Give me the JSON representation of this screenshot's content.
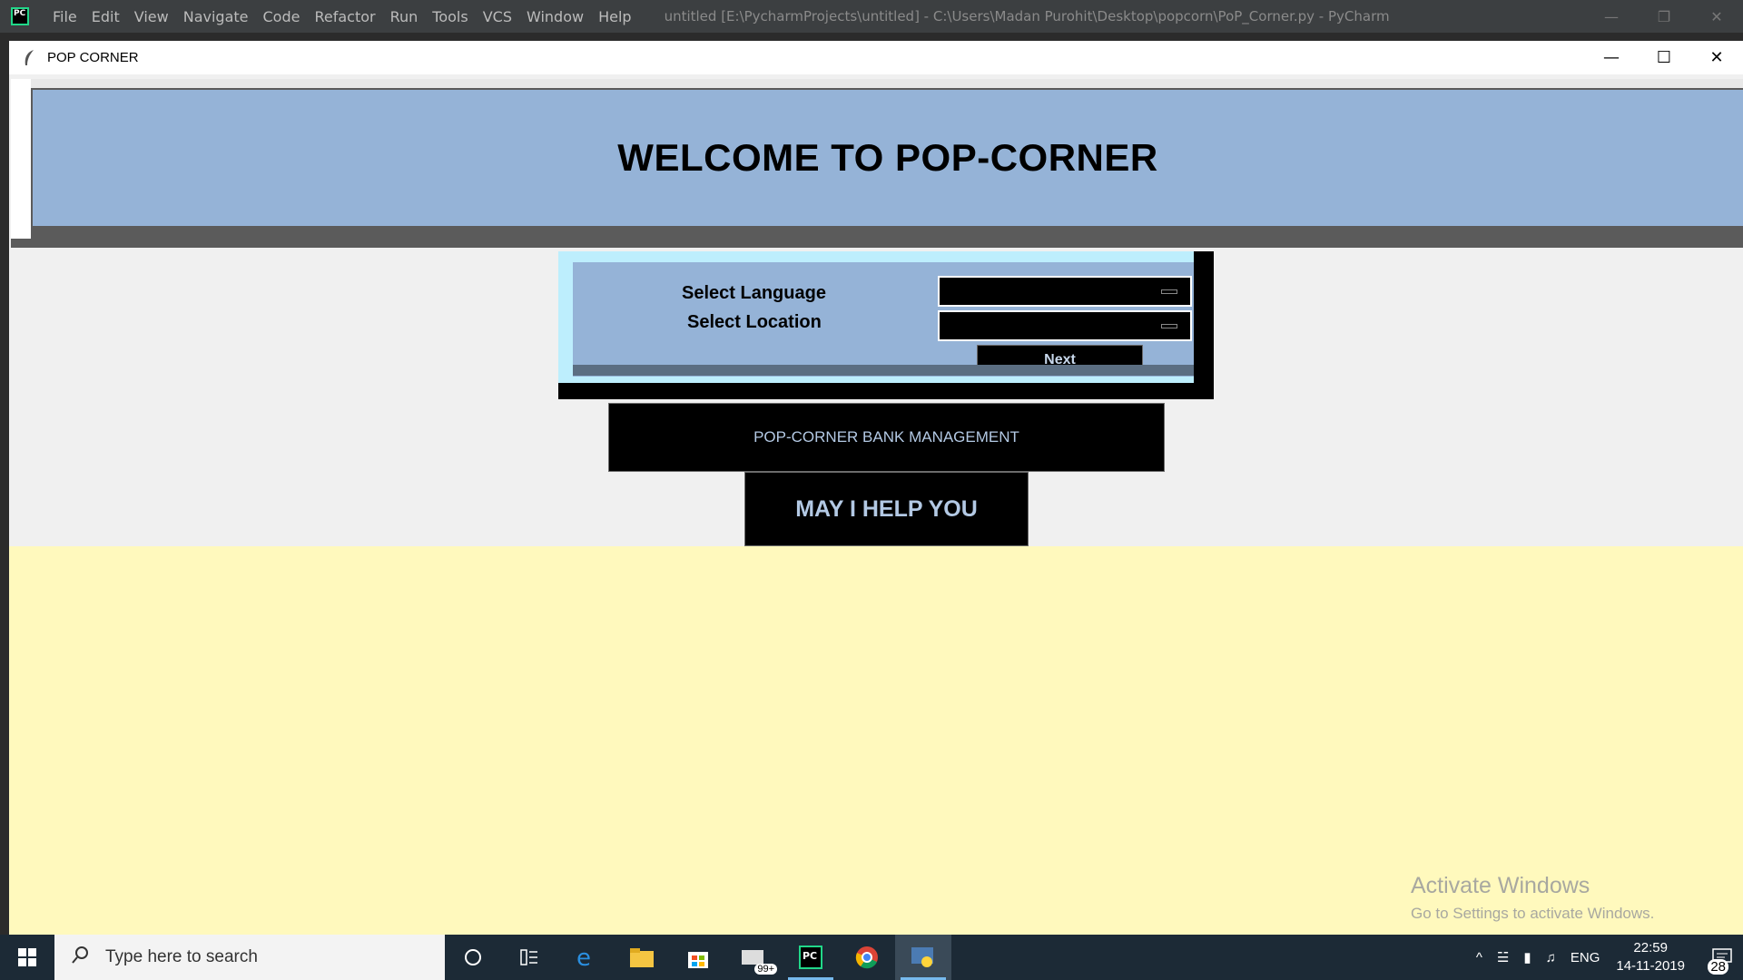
{
  "ide": {
    "menu": [
      "File",
      "Edit",
      "View",
      "Navigate",
      "Code",
      "Refactor",
      "Run",
      "Tools",
      "VCS",
      "Window",
      "Help"
    ],
    "title": "untitled [E:\\PycharmProjects\\untitled] - C:\\Users\\Madan Purohit\\Desktop\\popcorn\\PoP_Corner.py - PyCharm"
  },
  "window": {
    "title": "POP CORNER"
  },
  "header": {
    "title": "WELCOME TO POP-CORNER"
  },
  "form": {
    "language_label": "Select Language",
    "location_label": "Select Location",
    "language_value": "",
    "location_value": "",
    "next_label": "Next"
  },
  "buttons": {
    "bank": "POP-CORNER BANK MANAGEMENT",
    "help": "MAY I HELP YOU"
  },
  "watermark": {
    "line1": "Activate Windows",
    "line2": "Go to Settings to activate Windows."
  },
  "taskbar": {
    "search_placeholder": "Type here to search",
    "mail_badge": "99+",
    "lang": "ENG",
    "time": "22:59",
    "date": "14-11-2019",
    "notification_count": "28"
  },
  "colors": {
    "header_bg": "#95b3d7",
    "body_bg": "#fff9bd",
    "button_text": "#b3c9e4"
  }
}
